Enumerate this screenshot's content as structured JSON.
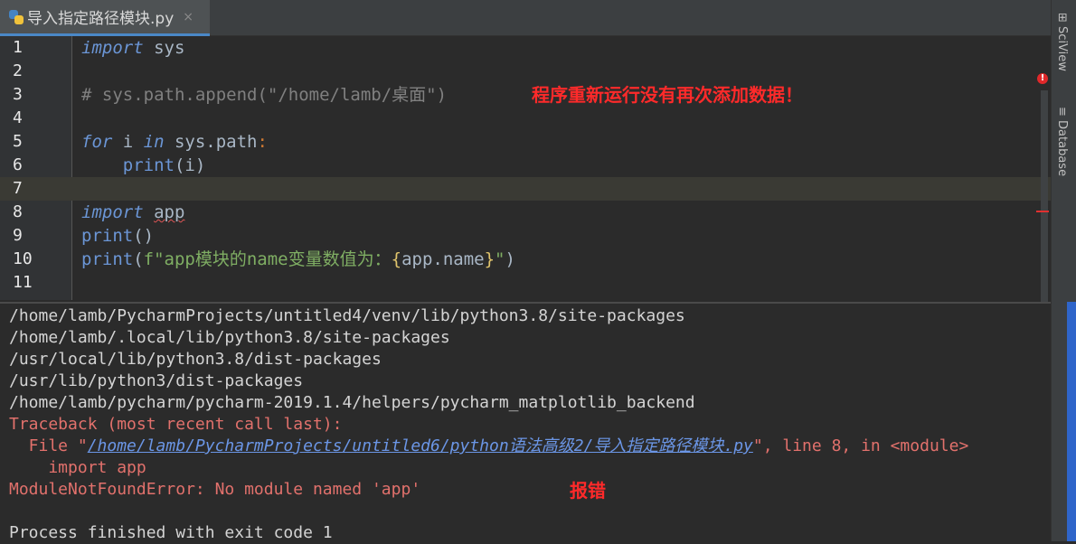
{
  "tab": {
    "filename": "导入指定路径模块.py",
    "close_glyph": "×"
  },
  "editor": {
    "lines": [
      {
        "num": "1"
      },
      {
        "num": "2"
      },
      {
        "num": "3"
      },
      {
        "num": "4"
      },
      {
        "num": "5"
      },
      {
        "num": "6"
      },
      {
        "num": "7"
      },
      {
        "num": "8"
      },
      {
        "num": "9"
      },
      {
        "num": "10"
      },
      {
        "num": "11"
      }
    ],
    "code": {
      "l1_kw": "import",
      "l1_rest": " sys",
      "l3_comment": "# sys.path.append(\"/home/lamb/桌面\")",
      "l5_for": "for",
      "l5_i": " i ",
      "l5_in": "in",
      "l5_rest": " sys.path",
      "l5_colon": ":",
      "l6_indent": "    ",
      "l6_print": "print",
      "l6_args": "(i)",
      "l8_kw": "import",
      "l8_space": " ",
      "l8_mod": "app",
      "l9_print": "print",
      "l9_args": "()",
      "l10_print": "print",
      "l10_open": "(",
      "l10_str1": "f\"app模块的name变量数值为：",
      "l10_br1": "{",
      "l10_expr": "app.name",
      "l10_br2": "}",
      "l10_str2": "\"",
      "l10_close": ")"
    },
    "annotation": "程序重新运行没有再次添加数据！",
    "error_indicator": "!"
  },
  "sidebar": {
    "sciview": "SciView",
    "database": "Database",
    "sciview_icon": "⊞",
    "database_icon": "≡"
  },
  "console": {
    "lines": [
      "/home/lamb/PycharmProjects/untitled4/venv/lib/python3.8/site-packages",
      "/home/lamb/.local/lib/python3.8/site-packages",
      "/usr/local/lib/python3.8/dist-packages",
      "/usr/lib/python3/dist-packages",
      "/home/lamb/pycharm/pycharm-2019.1.4/helpers/pycharm_matplotlib_backend"
    ],
    "traceback_header": "Traceback (most recent call last):",
    "file_prefix": "  File \"",
    "file_link": "/home/lamb/PycharmProjects/untitled6/python语法高级2/导入指定路径模块.py",
    "file_suffix": "\", line 8, in <module>",
    "code_line": "    import app",
    "error_msg": "ModuleNotFoundError: No module named 'app'",
    "annotation": "报错",
    "finished": "Process finished with exit code 1"
  },
  "colors": {
    "keyword": "#6b96d6",
    "string": "#7fae63",
    "error": "#e2716c",
    "annotation": "#ff2a2a",
    "accent": "#2f65ca"
  }
}
